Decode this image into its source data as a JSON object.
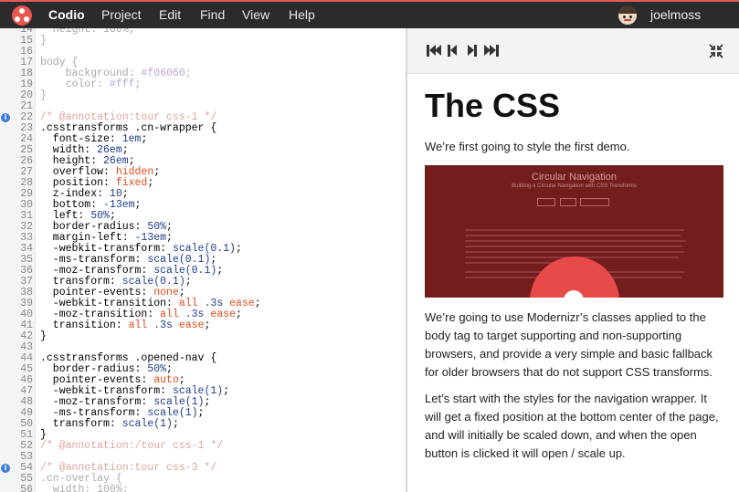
{
  "menubar": {
    "brand": "Codio",
    "items": [
      "Project",
      "Edit",
      "Find",
      "View",
      "Help"
    ],
    "user": "joelmoss",
    "accent": "#e8564f"
  },
  "editor": {
    "lines": [
      {
        "n": "14",
        "info": false,
        "html": "<span class='dim'>  height: 100%;</span>"
      },
      {
        "n": "15",
        "info": false,
        "html": "<span class='dim'>}</span>"
      },
      {
        "n": "16",
        "info": false,
        "html": ""
      },
      {
        "n": "17",
        "info": false,
        "html": "<span class='dim'>body {</span>"
      },
      {
        "n": "18",
        "info": false,
        "html": "<span class='dim'>    background: </span><span class='dimv'>#f06060</span><span class='dim'>;</span>"
      },
      {
        "n": "19",
        "info": false,
        "html": "<span class='dim'>    color: </span><span class='dimv'>#fff</span><span class='dim'>;</span>"
      },
      {
        "n": "20",
        "info": false,
        "html": "<span class='dim'>}</span>"
      },
      {
        "n": "21",
        "info": false,
        "html": ""
      },
      {
        "n": "22",
        "info": true,
        "html": "<span class='dimc'>/* @annotation:tour css-1 */</span>"
      },
      {
        "n": "23",
        "info": false,
        "html": ".csstransforms .cn-wrapper {"
      },
      {
        "n": "24",
        "info": false,
        "html": "  font-size: <span class='n'>1em</span>;"
      },
      {
        "n": "25",
        "info": false,
        "html": "  width: <span class='n'>26em</span>;"
      },
      {
        "n": "26",
        "info": false,
        "html": "  height: <span class='n'>26em</span>;"
      },
      {
        "n": "27",
        "info": false,
        "html": "  overflow: <span class='o'>hidden</span>;"
      },
      {
        "n": "28",
        "info": false,
        "html": "  position: <span class='o'>fixed</span>;"
      },
      {
        "n": "29",
        "info": false,
        "html": "  z-index: <span class='n'>10</span>;"
      },
      {
        "n": "30",
        "info": false,
        "html": "  bottom: <span class='n'>-13em</span>;"
      },
      {
        "n": "31",
        "info": false,
        "html": "  left: <span class='n'>50%</span>;"
      },
      {
        "n": "32",
        "info": false,
        "html": "  border-radius: <span class='n'>50%</span>;"
      },
      {
        "n": "33",
        "info": false,
        "html": "  margin-left: <span class='n'>-13em</span>;"
      },
      {
        "n": "34",
        "info": false,
        "html": "  -webkit-transform: <span class='n'>scale(0.1)</span>;"
      },
      {
        "n": "35",
        "info": false,
        "html": "  -ms-transform: <span class='n'>scale(0.1)</span>;"
      },
      {
        "n": "36",
        "info": false,
        "html": "  -moz-transform: <span class='n'>scale(0.1)</span>;"
      },
      {
        "n": "37",
        "info": false,
        "html": "  transform: <span class='n'>scale(0.1)</span>;"
      },
      {
        "n": "38",
        "info": false,
        "html": "  pointer-events: <span class='o'>none</span>;"
      },
      {
        "n": "39",
        "info": false,
        "html": "  -webkit-transition: <span class='o'>all</span> <span class='n'>.3s</span> <span class='o'>ease</span>;"
      },
      {
        "n": "40",
        "info": false,
        "html": "  -moz-transition: <span class='o'>all</span> <span class='n'>.3s</span> <span class='o'>ease</span>;"
      },
      {
        "n": "41",
        "info": false,
        "html": "  transition: <span class='o'>all</span> <span class='n'>.3s</span> <span class='o'>ease</span>;"
      },
      {
        "n": "42",
        "info": false,
        "html": "}"
      },
      {
        "n": "43",
        "info": false,
        "html": ""
      },
      {
        "n": "44",
        "info": false,
        "html": ".csstransforms .opened-nav {"
      },
      {
        "n": "45",
        "info": false,
        "html": "  border-radius: <span class='n'>50%</span>;"
      },
      {
        "n": "46",
        "info": false,
        "html": "  pointer-events: <span class='o'>auto</span>;"
      },
      {
        "n": "47",
        "info": false,
        "html": "  -webkit-transform: <span class='n'>scale(1)</span>;"
      },
      {
        "n": "48",
        "info": false,
        "html": "  -moz-transform: <span class='n'>scale(1)</span>;"
      },
      {
        "n": "49",
        "info": false,
        "html": "  -ms-transform: <span class='n'>scale(1)</span>;"
      },
      {
        "n": "50",
        "info": false,
        "html": "  transform: <span class='n'>scale(1)</span>;"
      },
      {
        "n": "51",
        "info": false,
        "html": "}"
      },
      {
        "n": "52",
        "info": false,
        "html": "<span class='dimc'>/* @annotation:/tour css-1 */</span>"
      },
      {
        "n": "53",
        "info": false,
        "html": ""
      },
      {
        "n": "54",
        "info": true,
        "html": "<span class='dimc'>/* @annotation:tour css-3 */</span>"
      },
      {
        "n": "55",
        "info": false,
        "html": "<span class='dim'>.cn-overlay {</span>"
      },
      {
        "n": "56",
        "info": false,
        "html": "<span class='dim'>  width: 100%;</span>"
      }
    ]
  },
  "preview": {
    "title": "The CSS",
    "intro": "We’re first going to style the first demo.",
    "demo": {
      "title": "Circular Navigation",
      "subtitle": "Building a Circular Navigation with CSS Transforms"
    },
    "paragraph1": "We’re going to use Modernizr’s classes applied to the body tag to target supporting and non-supporting browsers, and provide a very simple and basic fallback for older browsers that do not support CSS transforms.",
    "paragraph2": "Let’s start with the styles for the navigation wrapper. It will get a fixed position at the bottom center of the page, and will initially be scaled down, and when the open button is clicked it will open / scale up."
  }
}
